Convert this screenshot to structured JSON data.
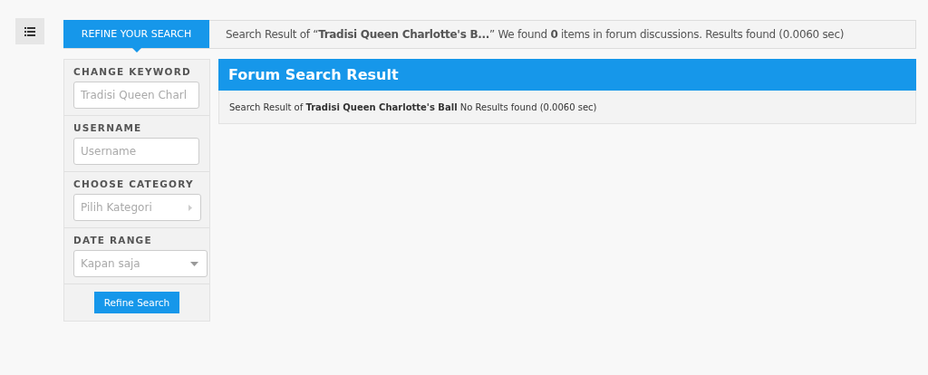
{
  "top_bar": {
    "tab": "REFINE YOUR SEARCH",
    "summary": "Search Result of “**Tradisi Queen Charlotte's B...**” We found **0** items in forum discussions. Results found (0.0060 sec)"
  },
  "filters": [
    {
      "kind": "text",
      "label": "CHANGE KEYWORD",
      "value": "Tradisi Queen Charl"
    },
    {
      "kind": "text",
      "label": "USERNAME",
      "placeholder": "Username"
    },
    {
      "kind": "select-side",
      "label": "CHOOSE CATEGORY",
      "value": "Pilih Kategori"
    },
    {
      "kind": "select-down",
      "label": "DATE RANGE",
      "value": "Kapan saja"
    }
  ],
  "refine_button": "Refine Search",
  "result": {
    "title": "Forum Search Result",
    "message": "Search Result of **Tradisi Queen Charlotte's Ball** No Results found (0.0060 sec)"
  }
}
